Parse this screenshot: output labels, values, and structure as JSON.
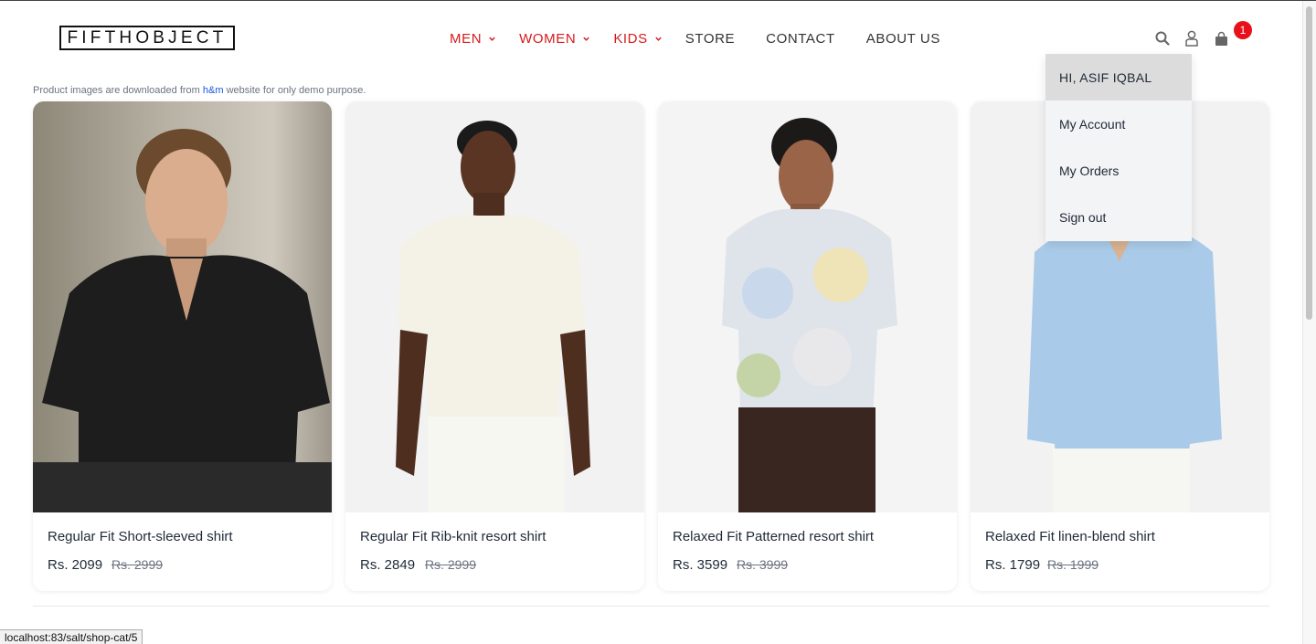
{
  "brand": {
    "logo": "FIFTHOBJECT"
  },
  "nav": [
    {
      "label": "MEN",
      "has_dropdown": true,
      "color": "#d7191c"
    },
    {
      "label": "WOMEN",
      "has_dropdown": true,
      "color": "#d7191c"
    },
    {
      "label": "KIDS",
      "has_dropdown": true,
      "color": "#d7191c"
    },
    {
      "label": "STORE",
      "has_dropdown": false
    },
    {
      "label": "CONTACT",
      "has_dropdown": false
    },
    {
      "label": "ABOUT US",
      "has_dropdown": false
    }
  ],
  "header_icons": {
    "search": "search-icon",
    "user": "user-icon",
    "cart": "shopping-bag-icon",
    "cart_count": "1"
  },
  "notice": {
    "prefix": "Product images are downloaded from ",
    "link": "h&m",
    "suffix": " website for only demo purpose."
  },
  "products": [
    {
      "title": "Regular Fit Short-sleeved shirt",
      "price": "Rs. 2099",
      "old_price": "Rs. 2999"
    },
    {
      "title": "Regular Fit Rib-knit resort shirt",
      "price": "Rs. 2849",
      "old_price": "Rs. 2999"
    },
    {
      "title": "Relaxed Fit Patterned resort shirt",
      "price": "Rs. 3599",
      "old_price": "Rs. 3999"
    },
    {
      "title": "Relaxed Fit linen-blend shirt",
      "price": "Rs. 1799",
      "old_price": "Rs. 1999"
    }
  ],
  "user_menu": {
    "greeting": "HI, ASIF IQBAL",
    "items": [
      "My Account",
      "My Orders",
      "Sign out"
    ]
  },
  "status_url": "localhost:83/salt/shop-cat/5",
  "colors": {
    "accent": "#d7191c",
    "badge": "#e8101b",
    "link": "#1a56db"
  }
}
